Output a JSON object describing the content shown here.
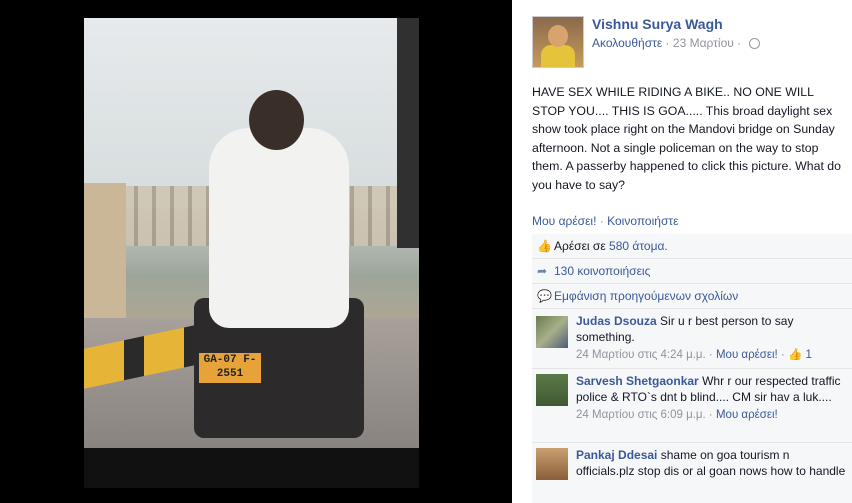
{
  "post": {
    "author": "Vishnu Surya Wagh",
    "follow": "Ακολουθήστε",
    "date": "23 Μαρτίου",
    "sep": "·",
    "text": "HAVE SEX WHILE RIDING A BIKE.. NO ONE WILL STOP YOU.... THIS IS GOA..... This broad daylight sex show took place right on the Mandovi bridge on Sunday afternoon. Not a single policeman on the way to stop them. A passerby happened to click this picture. What do you have to say?",
    "like_action": "Μου αρέσει!",
    "action_sep": "·",
    "share_action": "Κοινοποιήστε",
    "photo_plate": "GA-07 F-2551"
  },
  "summary": {
    "likes_prefix": "Αρέσει σε ",
    "likes_link": "580 άτομα.",
    "shares": "130 κοινοποιήσεις",
    "view_previous": "Εμφάνιση προηγούμενων σχολίων"
  },
  "comments": [
    {
      "name": "Judas Dsouza",
      "text": "Sir u r best person to say something.",
      "time": "24 Μαρτίου στις 4:24 μ.μ.",
      "like": "Μου αρέσει!",
      "likes": "1"
    },
    {
      "name": "Sarvesh Shetgaonkar",
      "text": "Whr r our respected traffic police & RTO`s dnt b blind.... CM sir hav a luk....",
      "time": "24 Μαρτίου στις 6:09 μ.μ.",
      "like": "Μου αρέσει!"
    },
    {
      "name": "Pankaj Ddesai",
      "text": "shame on goa tourism n officials.plz stop dis or al goan nows how to handle",
      "time": "",
      "like": ""
    }
  ],
  "colors": {
    "link": "#3b5998",
    "meta": "#90949c",
    "box": "#f6f7f9"
  },
  "icons": {
    "privacy": "globe-icon",
    "like": "thumbs-up-icon",
    "share": "share-arrow-icon",
    "comment": "comment-bubble-icon"
  }
}
